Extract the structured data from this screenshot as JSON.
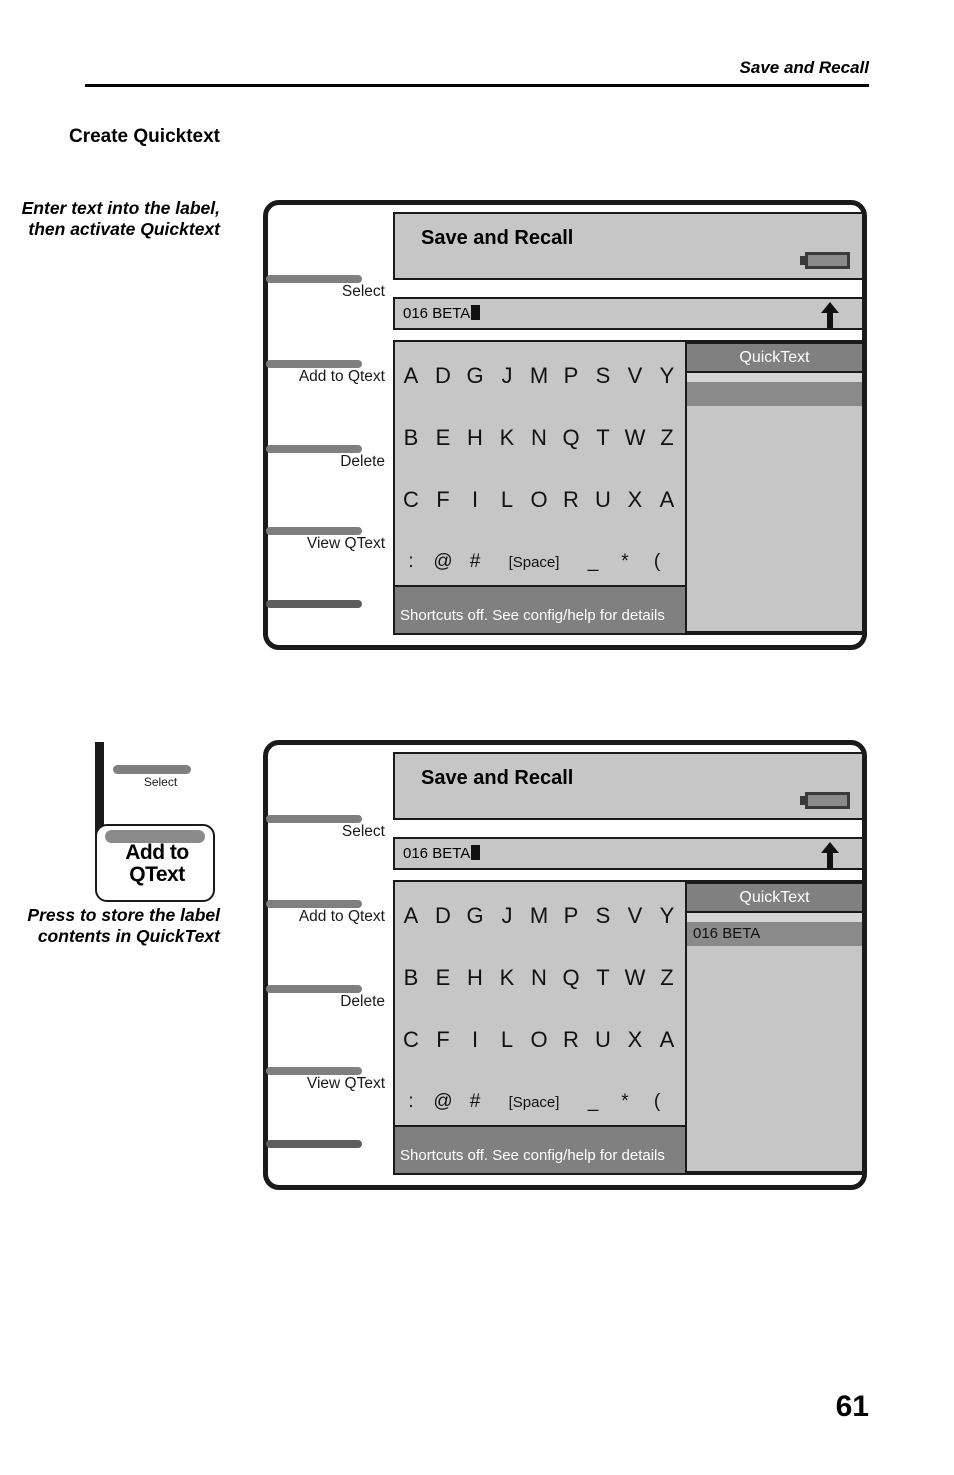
{
  "page": {
    "running_head": "Save and Recall",
    "folio": "61"
  },
  "margin_notes": {
    "heading": "Create Quicktext",
    "instruction": "Enter text into the label, then activate Quicktext",
    "press_note": "Press to store the label contents in QuickText"
  },
  "callout": {
    "softkey_label": "Select",
    "highlight_label": "Add to QText"
  },
  "colors": {
    "screen_bg": "#c6c6c6",
    "title_bar_bg": "#808080",
    "frame": "#1a1a1a",
    "softkey_bar": "#7f7f7f",
    "softkey_bar_dark": "#5e5e5e",
    "selected_row": "#8a8a8a",
    "status_text": "#ffffff"
  },
  "softkeys": [
    {
      "label": "Select"
    },
    {
      "label": "Add to Qtext"
    },
    {
      "label": "Delete"
    },
    {
      "label": "View QText"
    }
  ],
  "screen": {
    "title": "Save and Recall",
    "battery_icon": "battery-icon",
    "entry_value": "016 BETA",
    "shift_icon": "up-arrow-icon",
    "status_message": "Shortcuts off. See config/help for details",
    "quicktext_panel_title": "QuickText",
    "keyboard_rows": [
      [
        "A",
        "D",
        "G",
        "J",
        "M",
        "P",
        "S",
        "V",
        "Y"
      ],
      [
        "B",
        "E",
        "H",
        "K",
        "N",
        "Q",
        "T",
        "W",
        "Z"
      ],
      [
        "C",
        "F",
        "I",
        "L",
        "O",
        "R",
        "U",
        "X",
        "A"
      ],
      [
        ":",
        "@",
        "#",
        "[Space]",
        "_",
        "*",
        "("
      ]
    ]
  },
  "device_1": {
    "quicktext_entry": ""
  },
  "device_2": {
    "quicktext_entry": "016 BETA"
  }
}
